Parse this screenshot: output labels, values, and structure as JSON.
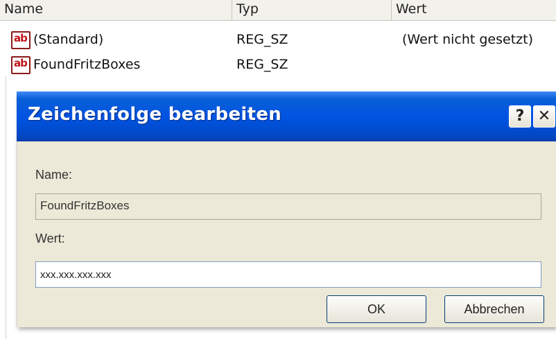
{
  "list": {
    "columns": {
      "name": "Name",
      "typ": "Typ",
      "wert": "Wert"
    },
    "rows": [
      {
        "icon": "reg-string-icon",
        "name": "(Standard)",
        "typ": "REG_SZ",
        "wert": "(Wert nicht gesetzt)"
      },
      {
        "icon": "reg-string-icon",
        "name": "FoundFritzBoxes",
        "typ": "REG_SZ",
        "wert": ""
      }
    ],
    "icon_text": "ab"
  },
  "dialog": {
    "title": "Zeichenfolge bearbeiten",
    "help_label": "?",
    "close_label": "✕",
    "name_label": "Name:",
    "name_value": "FoundFritzBoxes",
    "wert_label": "Wert:",
    "wert_value": "xxx.xxx.xxx.xxx",
    "ok_label": "OK",
    "cancel_label": "Abbrechen"
  },
  "colors": {
    "titlebar": "#0054e3",
    "dialog_bg": "#ece9d8",
    "icon_red": "#c0121a"
  }
}
